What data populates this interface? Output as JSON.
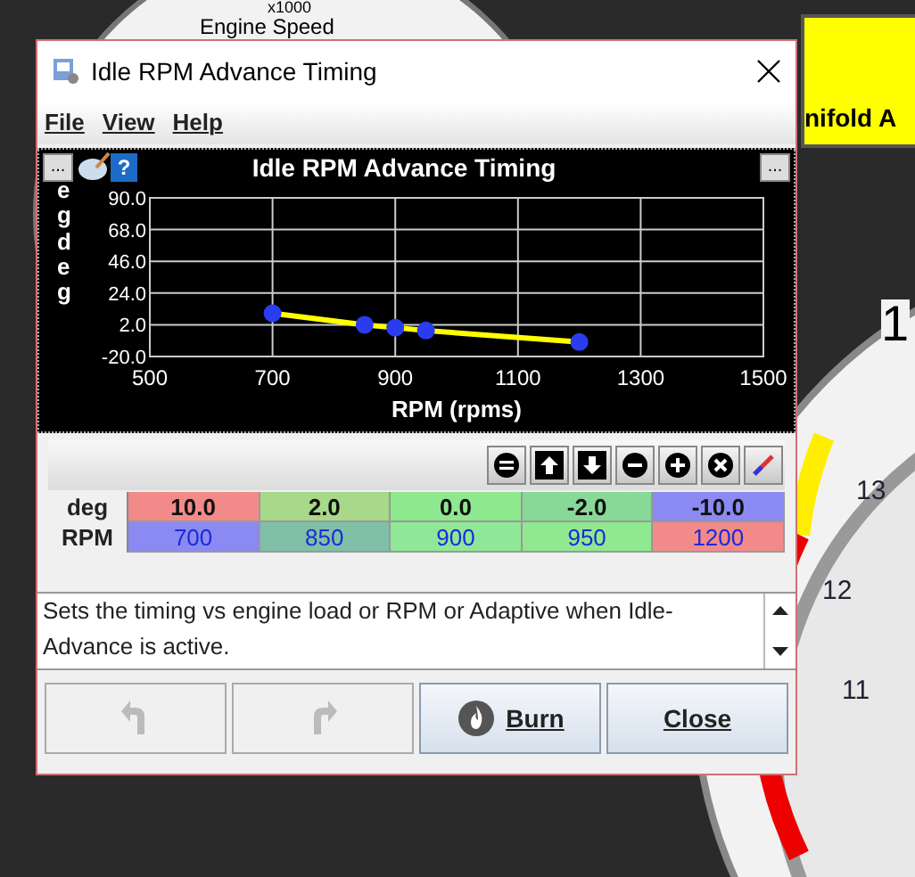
{
  "background": {
    "gauge_unit": "x1000",
    "gauge_title": "Engine Speed",
    "banner_text": "nifold A",
    "gauge_numbers": [
      "1",
      "13",
      "12",
      "11"
    ]
  },
  "window": {
    "title": "Idle RPM Advance Timing"
  },
  "menu": [
    {
      "label": "File"
    },
    {
      "label": "View"
    },
    {
      "label": "Help"
    }
  ],
  "chart_panel": {
    "left_button": "...",
    "right_button": "...",
    "help": "?",
    "chart_data": {
      "type": "line",
      "title": "Idle RPM Advance Timing",
      "xlabel": "RPM (rpms)",
      "ylabel": "eg deg",
      "x": [
        700,
        850,
        900,
        950,
        1200
      ],
      "grid": true,
      "series": [
        {
          "color": "#ffff00",
          "marker": "circle",
          "values": [
            10,
            2,
            0,
            -2,
            -10
          ]
        }
      ],
      "xlim": [
        500,
        1500
      ],
      "ylim": [
        -20,
        90
      ],
      "xticks": [
        500,
        700,
        900,
        1100,
        1300,
        1500
      ],
      "yticks": [
        {
          "value": -20,
          "label": "-20.0"
        },
        {
          "value": 2,
          "label": "2.0"
        },
        {
          "value": 24,
          "label": "24.0"
        },
        {
          "value": 46,
          "label": "46.0"
        },
        {
          "value": 68,
          "label": "68.0"
        },
        {
          "value": 90,
          "label": "90.0"
        }
      ]
    }
  },
  "toolbar": [
    {
      "kind": "equal"
    },
    {
      "kind": "up"
    },
    {
      "kind": "down"
    },
    {
      "kind": "minus"
    },
    {
      "kind": "plus"
    },
    {
      "kind": "times"
    },
    {
      "kind": "pen"
    }
  ],
  "table": {
    "rows": [
      {
        "label": "deg",
        "kind": "value",
        "cells": [
          {
            "text": "10.0",
            "color": "#f28a8a"
          },
          {
            "text": "2.0",
            "color": "#a8d88a"
          },
          {
            "text": "0.0",
            "color": "#8ee88e"
          },
          {
            "text": "-2.0",
            "color": "#88d898"
          },
          {
            "text": "-10.0",
            "color": "#8a8af2"
          }
        ]
      },
      {
        "label": "RPM",
        "kind": "axis",
        "cells": [
          {
            "text": "700",
            "color": "#8a8af2"
          },
          {
            "text": "850",
            "color": "#80c0a8"
          },
          {
            "text": "900",
            "color": "#8ee898"
          },
          {
            "text": "950",
            "color": "#90e890"
          },
          {
            "text": "1200",
            "color": "#f28a8a"
          }
        ]
      }
    ]
  },
  "description": "Sets the timing vs engine load or RPM or Adaptive when Idle-Advance is active.",
  "buttons": [
    {
      "kind": "undo",
      "disabled": true
    },
    {
      "kind": "redo",
      "disabled": true
    },
    {
      "kind": "burn",
      "label": "Burn",
      "disabled": false
    },
    {
      "kind": "close",
      "label": "Close",
      "disabled": false
    }
  ]
}
